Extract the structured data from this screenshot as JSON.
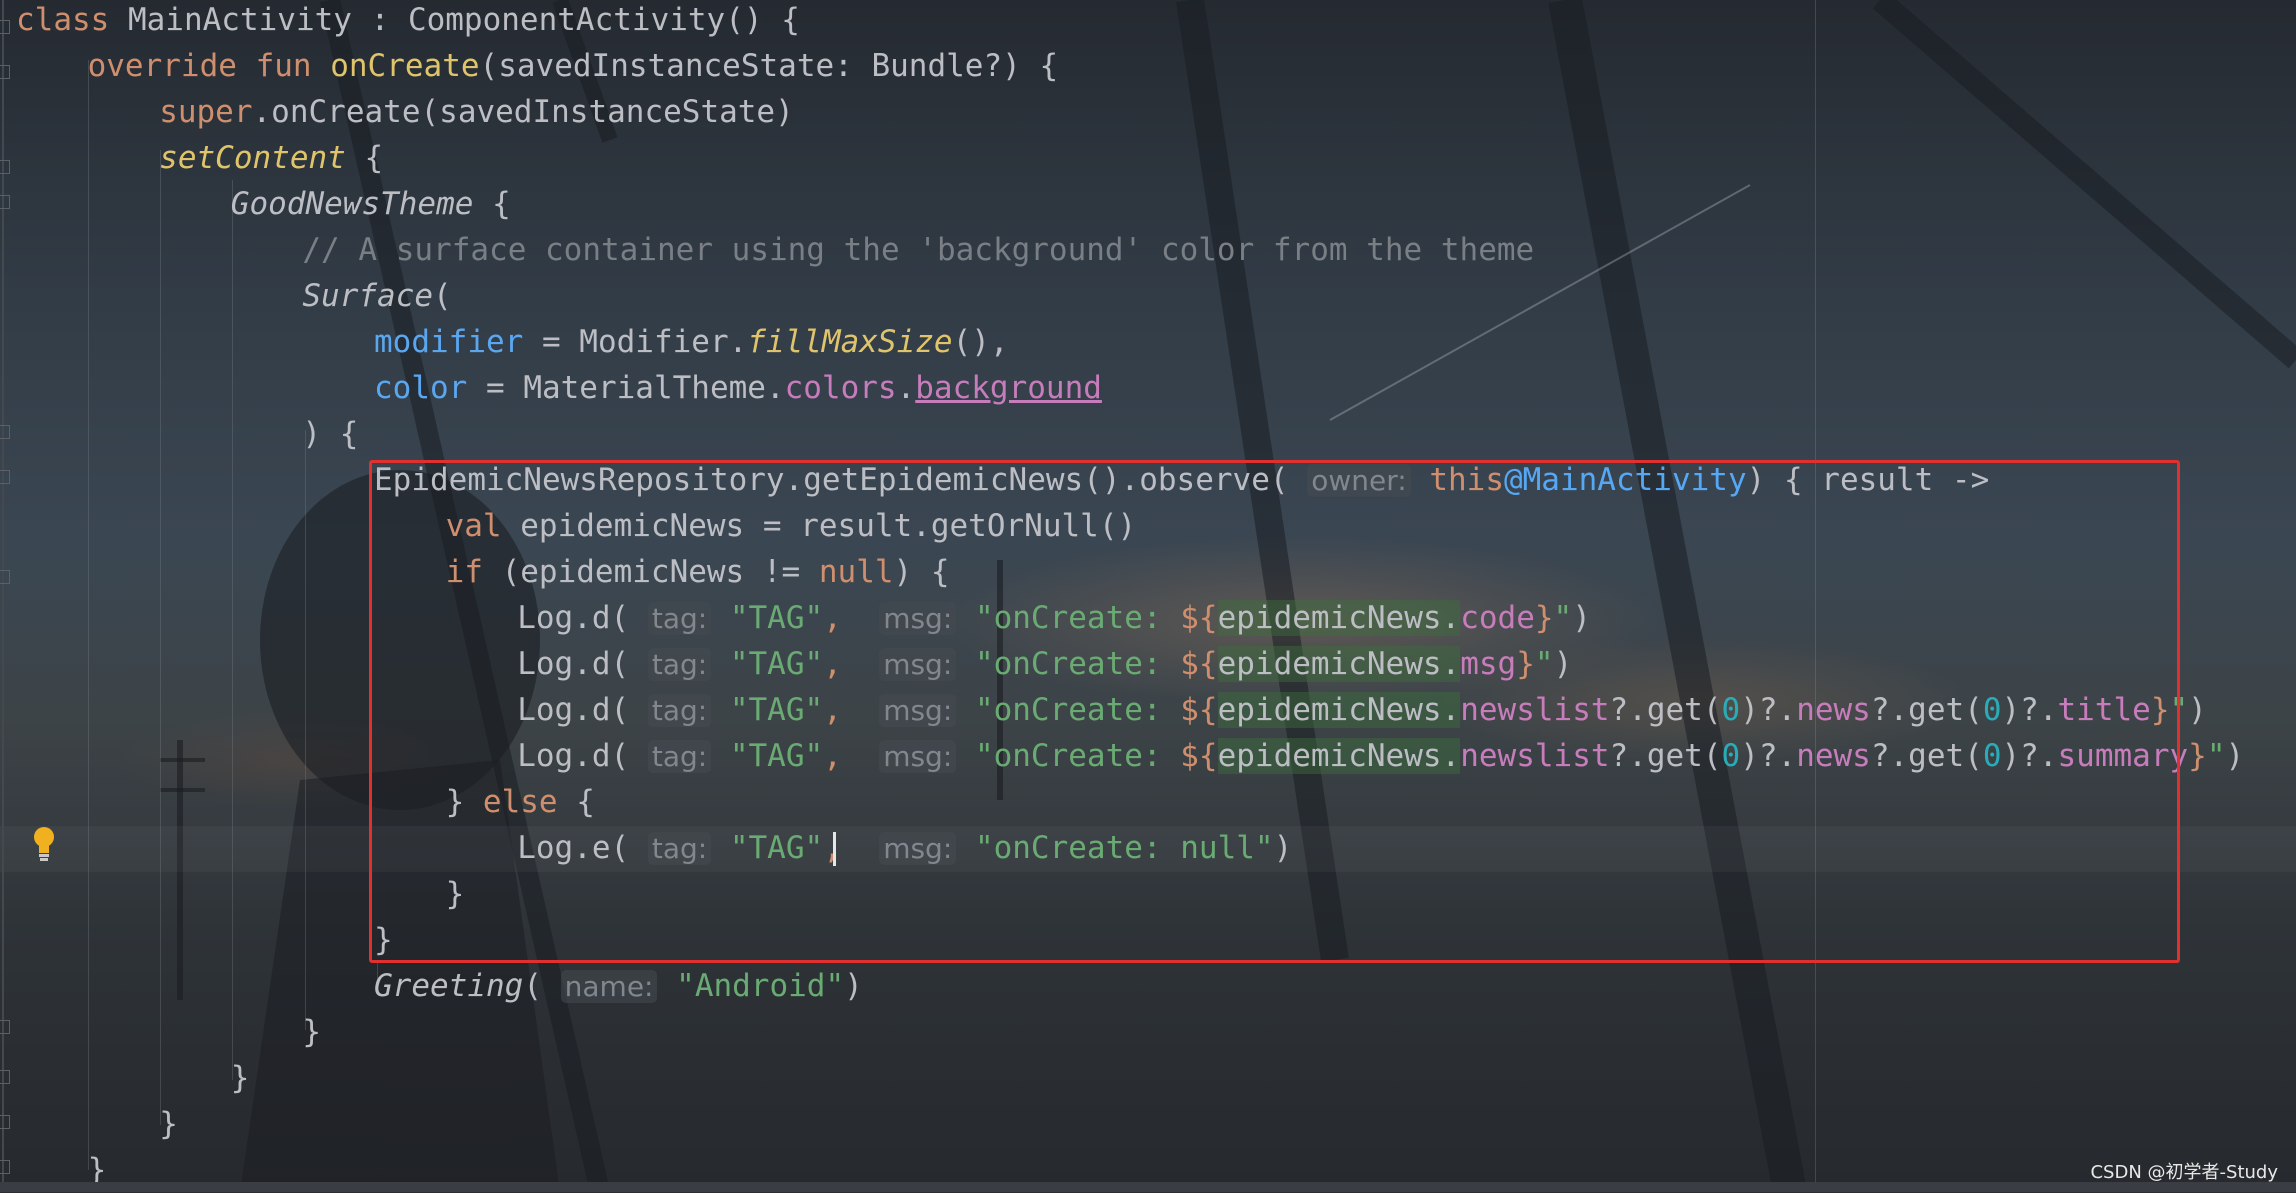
{
  "editor": {
    "lines": [
      {
        "indent": 0,
        "tokens": [
          {
            "t": "class ",
            "c": "kw"
          },
          {
            "t": "MainActivity : ComponentActivity() {"
          }
        ]
      },
      {
        "indent": 1,
        "tokens": [
          {
            "t": "override fun ",
            "c": "kw"
          },
          {
            "t": "onCreate",
            "c": "fn-decl"
          },
          {
            "t": "(savedInstanceState: Bundle?) {"
          }
        ]
      },
      {
        "indent": 2,
        "tokens": [
          {
            "t": "super",
            "c": "kw"
          },
          {
            "t": ".onCreate(savedInstanceState)"
          }
        ]
      },
      {
        "indent": 2,
        "tokens": [
          {
            "t": "setContent",
            "c": "fn-decl it"
          },
          {
            "t": " {"
          }
        ]
      },
      {
        "indent": 3,
        "tokens": [
          {
            "t": "GoodNewsTheme",
            "c": "it"
          },
          {
            "t": " {"
          }
        ]
      },
      {
        "indent": 4,
        "tokens": [
          {
            "t": "// A surface container using the 'background' color from the theme",
            "c": "cmt"
          }
        ]
      },
      {
        "indent": 4,
        "tokens": [
          {
            "t": "Surface",
            "c": "it"
          },
          {
            "t": "("
          }
        ]
      },
      {
        "indent": 5,
        "tokens": [
          {
            "t": "modifier",
            "c": "param"
          },
          {
            "t": " = Modifier."
          },
          {
            "t": "fillMaxSize",
            "c": "fn-decl it"
          },
          {
            "t": "(),"
          }
        ]
      },
      {
        "indent": 5,
        "tokens": [
          {
            "t": "color",
            "c": "param"
          },
          {
            "t": " = MaterialTheme."
          },
          {
            "t": "colors",
            "c": "prop"
          },
          {
            "t": "."
          },
          {
            "t": "background",
            "c": "prop und"
          }
        ]
      },
      {
        "indent": 4,
        "tokens": [
          {
            "t": ") {"
          }
        ]
      },
      {
        "indent": 5,
        "tokens": [
          {
            "t": "EpidemicNewsRepository.getEpidemicNews().observe( "
          },
          {
            "t": "owner:",
            "c": "hint"
          },
          {
            "t": " "
          },
          {
            "t": "this",
            "c": "kw"
          },
          {
            "t": "@MainActivity",
            "c": "lbl"
          },
          {
            "t": ") { result ->"
          }
        ]
      },
      {
        "indent": 6,
        "tokens": [
          {
            "t": "val ",
            "c": "kw"
          },
          {
            "t": "epidemicNews = result.getOrNull()"
          }
        ]
      },
      {
        "indent": 6,
        "tokens": [
          {
            "t": "if ",
            "c": "kw"
          },
          {
            "t": "(epidemicNews != "
          },
          {
            "t": "null",
            "c": "kw"
          },
          {
            "t": ") {"
          }
        ]
      },
      {
        "indent": 7,
        "tokens": [
          {
            "t": "Log.d( "
          },
          {
            "t": "tag:",
            "c": "hint"
          },
          {
            "t": " "
          },
          {
            "t": "\"TAG\"",
            "c": "str"
          },
          {
            "t": ", ",
            "c": "kw"
          },
          {
            "t": " "
          },
          {
            "t": "msg:",
            "c": "hint"
          },
          {
            "t": " "
          },
          {
            "t": "\"onCreate: ",
            "c": "str"
          },
          {
            "t": "${",
            "c": "tmpl"
          },
          {
            "t": "epidemicNews",
            "c": "hl-green"
          },
          {
            "t": ".",
            "c": "hl-green"
          },
          {
            "t": "code",
            "c": "prop"
          },
          {
            "t": "}",
            "c": "tmpl"
          },
          {
            "t": "\"",
            "c": "str"
          },
          {
            "t": ")"
          }
        ]
      },
      {
        "indent": 7,
        "tokens": [
          {
            "t": "Log.d( "
          },
          {
            "t": "tag:",
            "c": "hint"
          },
          {
            "t": " "
          },
          {
            "t": "\"TAG\"",
            "c": "str"
          },
          {
            "t": ", ",
            "c": "kw"
          },
          {
            "t": " "
          },
          {
            "t": "msg:",
            "c": "hint"
          },
          {
            "t": " "
          },
          {
            "t": "\"onCreate: ",
            "c": "str"
          },
          {
            "t": "${",
            "c": "tmpl"
          },
          {
            "t": "epidemicNews",
            "c": "hl-green"
          },
          {
            "t": ".",
            "c": "hl-green"
          },
          {
            "t": "msg",
            "c": "prop"
          },
          {
            "t": "}",
            "c": "tmpl"
          },
          {
            "t": "\"",
            "c": "str"
          },
          {
            "t": ")"
          }
        ]
      },
      {
        "indent": 7,
        "tokens": [
          {
            "t": "Log.d( "
          },
          {
            "t": "tag:",
            "c": "hint"
          },
          {
            "t": " "
          },
          {
            "t": "\"TAG\"",
            "c": "str"
          },
          {
            "t": ", ",
            "c": "kw"
          },
          {
            "t": " "
          },
          {
            "t": "msg:",
            "c": "hint"
          },
          {
            "t": " "
          },
          {
            "t": "\"onCreate: ",
            "c": "str"
          },
          {
            "t": "${",
            "c": "tmpl"
          },
          {
            "t": "epidemicNews",
            "c": "hl-green"
          },
          {
            "t": ".",
            "c": "hl-green"
          },
          {
            "t": "newslist",
            "c": "prop"
          },
          {
            "t": "?.get("
          },
          {
            "t": "0",
            "c": "num"
          },
          {
            "t": ")?."
          },
          {
            "t": "news",
            "c": "prop"
          },
          {
            "t": "?.get("
          },
          {
            "t": "0",
            "c": "num"
          },
          {
            "t": ")?."
          },
          {
            "t": "title",
            "c": "prop"
          },
          {
            "t": "}",
            "c": "tmpl"
          },
          {
            "t": "\"",
            "c": "str"
          },
          {
            "t": ")"
          }
        ]
      },
      {
        "indent": 7,
        "tokens": [
          {
            "t": "Log.d( "
          },
          {
            "t": "tag:",
            "c": "hint"
          },
          {
            "t": " "
          },
          {
            "t": "\"TAG\"",
            "c": "str"
          },
          {
            "t": ", ",
            "c": "kw"
          },
          {
            "t": " "
          },
          {
            "t": "msg:",
            "c": "hint"
          },
          {
            "t": " "
          },
          {
            "t": "\"onCreate: ",
            "c": "str"
          },
          {
            "t": "${",
            "c": "tmpl"
          },
          {
            "t": "epidemicNews",
            "c": "hl-green"
          },
          {
            "t": ".",
            "c": "hl-green"
          },
          {
            "t": "newslist",
            "c": "prop"
          },
          {
            "t": "?.get("
          },
          {
            "t": "0",
            "c": "num"
          },
          {
            "t": ")?."
          },
          {
            "t": "news",
            "c": "prop"
          },
          {
            "t": "?.get("
          },
          {
            "t": "0",
            "c": "num"
          },
          {
            "t": ")?."
          },
          {
            "t": "summary",
            "c": "prop"
          },
          {
            "t": "}",
            "c": "tmpl"
          },
          {
            "t": "\"",
            "c": "str"
          },
          {
            "t": ")"
          }
        ]
      },
      {
        "indent": 6,
        "tokens": [
          {
            "t": "} "
          },
          {
            "t": "else",
            "c": "kw"
          },
          {
            "t": " {"
          }
        ]
      },
      {
        "indent": 7,
        "tokens": [
          {
            "t": "Log.e( "
          },
          {
            "t": "tag:",
            "c": "hint"
          },
          {
            "t": " "
          },
          {
            "t": "\"TAG\"",
            "c": "str"
          },
          {
            "t": ", ",
            "c": "kw"
          },
          {
            "t": " "
          },
          {
            "t": "msg:",
            "c": "hint"
          },
          {
            "t": " "
          },
          {
            "t": "\"onCreate: null\"",
            "c": "str"
          },
          {
            "t": ")"
          }
        ]
      },
      {
        "indent": 6,
        "tokens": [
          {
            "t": "}"
          }
        ]
      },
      {
        "indent": 5,
        "tokens": [
          {
            "t": "}"
          }
        ]
      },
      {
        "indent": 5,
        "tokens": [
          {
            "t": "Greeting",
            "c": "it"
          },
          {
            "t": "( "
          },
          {
            "t": "name:",
            "c": "hint"
          },
          {
            "t": " "
          },
          {
            "t": "\"Android\"",
            "c": "str"
          },
          {
            "t": ")"
          }
        ]
      },
      {
        "indent": 4,
        "tokens": [
          {
            "t": "}"
          }
        ]
      },
      {
        "indent": 3,
        "tokens": [
          {
            "t": "}"
          }
        ]
      },
      {
        "indent": 2,
        "tokens": [
          {
            "t": "}"
          }
        ]
      },
      {
        "indent": 1,
        "tokens": [
          {
            "t": "}"
          }
        ]
      }
    ]
  },
  "watermark": "CSDN @初学者-Study",
  "colors": {
    "keyword": "#cf8e6d",
    "function": "#e0c46c",
    "string": "#6aab73",
    "property": "#c77dbb",
    "parameter": "#5aa7f0",
    "comment": "#7a7e85",
    "highlight_box": "#e03030"
  },
  "icons": {
    "intention": "lightbulb-icon"
  }
}
